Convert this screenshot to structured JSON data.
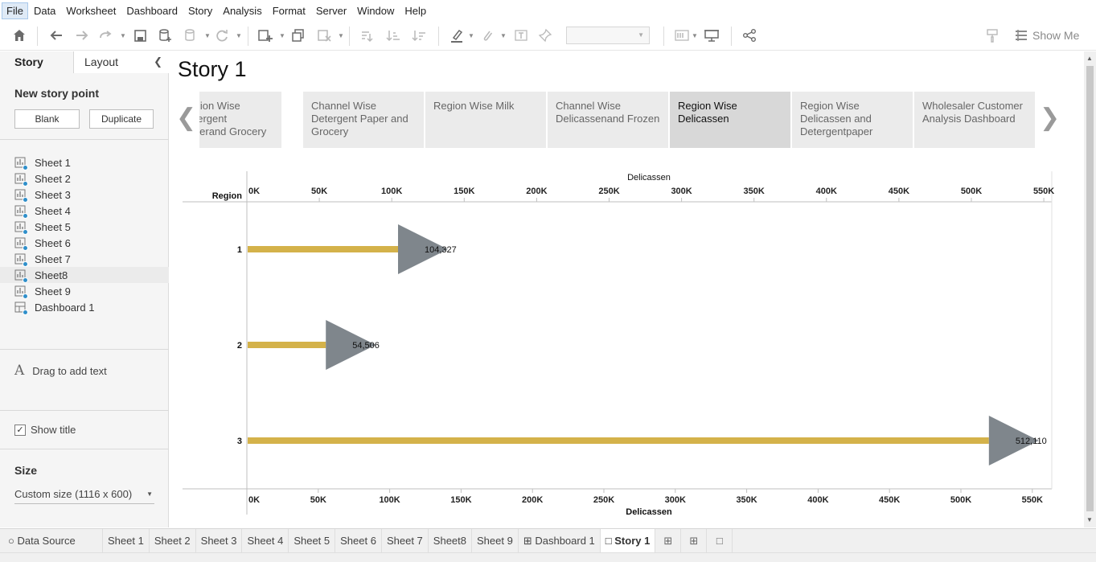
{
  "menu": [
    "File",
    "Data",
    "Worksheet",
    "Dashboard",
    "Story",
    "Analysis",
    "Format",
    "Server",
    "Window",
    "Help"
  ],
  "toolbar": {
    "show_me": "Show Me"
  },
  "sidebar": {
    "tab_story": "Story",
    "tab_layout": "Layout",
    "new_story_point": "New story point",
    "blank": "Blank",
    "duplicate": "Duplicate",
    "sheets": [
      {
        "label": "Sheet 1",
        "kind": "sheet"
      },
      {
        "label": "Sheet 2",
        "kind": "sheet"
      },
      {
        "label": "Sheet 3",
        "kind": "sheet"
      },
      {
        "label": "Sheet 4",
        "kind": "sheet"
      },
      {
        "label": "Sheet 5",
        "kind": "sheet"
      },
      {
        "label": "Sheet 6",
        "kind": "sheet"
      },
      {
        "label": "Sheet 7",
        "kind": "sheet"
      },
      {
        "label": "Sheet8",
        "kind": "sheet"
      },
      {
        "label": "Sheet 9",
        "kind": "sheet"
      },
      {
        "label": "Dashboard 1",
        "kind": "dashboard"
      }
    ],
    "drag_text": "Drag to add text",
    "show_title": "Show title",
    "size_title": "Size",
    "size_value": "Custom size (1116 x 600)"
  },
  "story": {
    "title": "Story 1",
    "points": [
      {
        "label": "Region Wise Detergent Paperand Grocery",
        "active": false
      },
      {
        "label": "Channel Wise Detergent Paper and Grocery",
        "active": false
      },
      {
        "label": "Region Wise Milk",
        "active": false
      },
      {
        "label": "Channel Wise Delicassenand Frozen",
        "active": false
      },
      {
        "label": "Region Wise Delicassen",
        "active": true
      },
      {
        "label": "Region Wise Delicassen  and Detergentpaper",
        "active": false
      },
      {
        "label": "Wholesaler Customer Analysis  Dashboard",
        "active": false
      }
    ]
  },
  "chart_data": {
    "type": "bar",
    "categories": [
      "1",
      "2",
      "3"
    ],
    "values": [
      104327,
      54506,
      512110
    ],
    "value_labels": [
      "104,327",
      "54,506",
      "512,110"
    ],
    "xlabel": "Delicassen",
    "ylabel": "Region",
    "xlim": [
      0,
      560000
    ],
    "ticks": [
      "0K",
      "50K",
      "100K",
      "150K",
      "200K",
      "250K",
      "300K",
      "350K",
      "400K",
      "450K",
      "500K",
      "550K"
    ],
    "tick_values": [
      0,
      50000,
      100000,
      150000,
      200000,
      250000,
      300000,
      350000,
      400000,
      450000,
      500000,
      550000
    ],
    "bar_color": "#d4b24a",
    "marker_color": "#7f868c",
    "marker": "triangle-right"
  },
  "bottom_tabs": {
    "data_source": "Data Source",
    "sheets": [
      "Sheet 1",
      "Sheet 2",
      "Sheet 3",
      "Sheet 4",
      "Sheet 5",
      "Sheet 6",
      "Sheet 7",
      "Sheet8",
      "Sheet 9"
    ],
    "dashboard": "Dashboard 1",
    "story": "Story 1"
  }
}
